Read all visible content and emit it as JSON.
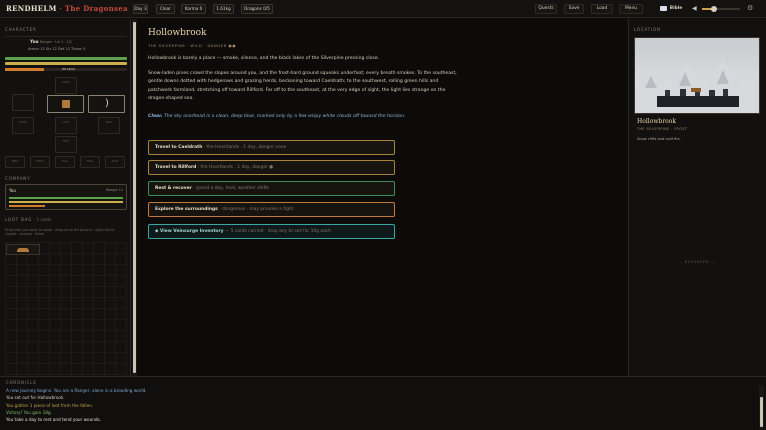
{
  "brand": {
    "name": "RENDHELM",
    "sep": " · ",
    "subtitle": "The Dragonsea"
  },
  "topbar": {
    "chips": [
      "Day 3",
      "Clear",
      "Karma 0",
      "1.61kg",
      "Dragons 0/5"
    ],
    "buttons": [
      "Quests",
      "Save",
      "Load",
      "Menu"
    ],
    "bible_label": "Bible"
  },
  "character": {
    "section": "CHARACTER",
    "name": "You",
    "class_line": "Ranger · Lvl 1 · 2/1",
    "stats": "Armor 12  Str 12  Def 12  Tinker 5",
    "hp_label": "HP 14/14",
    "slots": [
      "",
      "HEAD",
      "",
      "CHEST",
      "MAIN",
      "OFF",
      "HAND",
      "LEGS",
      "RING",
      "",
      "FEET",
      "",
      "BELT",
      "NECK",
      "BAG",
      "TOOL",
      "PACK"
    ]
  },
  "company": {
    "section": "COMPANY",
    "member_name": "You",
    "member_role": "Ranger L1"
  },
  "loot": {
    "section": "LOOT BAG",
    "count": "· 1 cards",
    "hint": "Drag onto your body to equip · drag out to the ground · right-click to inspect · arrange · tinker"
  },
  "location": {
    "title": "Hollowbrook",
    "tags": "THE SILVERPINE · WILD · DANGER ●●",
    "para1": "Hollowbrook is barely a place — smoke, silence, and the black lakes of the Silverpine pressing close.",
    "para2": "Snow-laden pines crowd the slopes around you, and the frost-hard ground squeaks underfoot; every breath smokes. To the southeast, gentle downs dotted with hedgerows and grazing herds, beckoning toward Caeldrath; to the southwest, rolling green hills and patchwork farmland, stretching off toward Rillford. Far off to the southeast, at the very edge of sight, the light lies strange on the dragon-shaped sea.",
    "weather_label": "Clear.",
    "weather_text": " The sky overhead is a clean, deep blue, marked only by a few wispy white clouds off toward the horizon."
  },
  "options": [
    {
      "main": "Travel to Caeldrath",
      "sub": "· the Heartlands · 1 day, danger none"
    },
    {
      "main": "Travel to Rillford",
      "sub": "· the Heartlands · 1 day, danger ●"
    },
    {
      "main": "Rest & recover",
      "sub": "· spend a day, heal, weather shifts"
    },
    {
      "main": "Explore the surroundings",
      "sub": "· dangerous · may provoke a fight"
    },
    {
      "main": "◆ View Veinsurge Inventory",
      "sub": "— 5 cards carried · drop any to sell for 10g each"
    }
  ],
  "right_panel": {
    "section": "LOCATION",
    "name": "Hollowbrook",
    "tags": "THE SILVERPINE · FROST",
    "desc": "Snow cliffs and cold firs.",
    "reserved": "— RESERVED —"
  },
  "chronicle": {
    "section": "CHRONICLE",
    "lines": [
      "A new journey begins. You are a Ranger, alone in a brooding world.",
      "You set out for Hollowbrook.",
      "You gather 1 piece of loot from the fallen.",
      "Victory! You gain 18g.",
      "You take a day to rest and tend your wounds."
    ]
  },
  "colors": {
    "accent": "#c8493c",
    "gold": "#c9a24a",
    "green": "#5fa04a",
    "teal": "#3aa8a0",
    "orange": "#d07a2a"
  }
}
